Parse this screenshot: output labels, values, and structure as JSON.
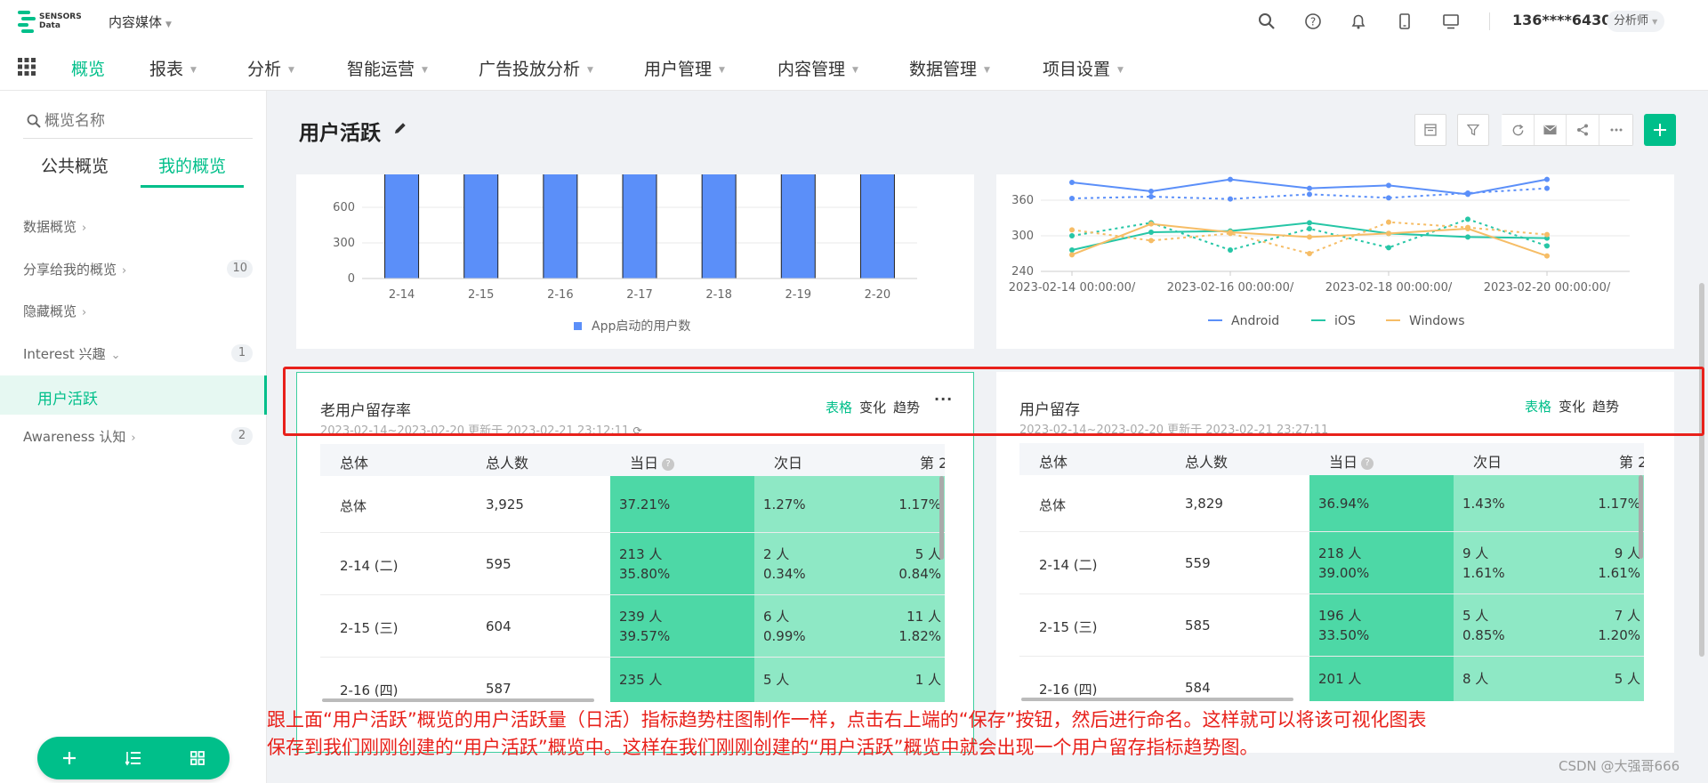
{
  "brand": {
    "name_line1": "SENSORS",
    "name_line2": "Data"
  },
  "workspace": "内容媒体",
  "user": {
    "phone": "136****6430",
    "role": "分析师"
  },
  "nav": [
    {
      "label": "概览",
      "active": true,
      "dropdown": false
    },
    {
      "label": "报表",
      "dropdown": true
    },
    {
      "label": "分析",
      "dropdown": true
    },
    {
      "label": "智能运营",
      "dropdown": true
    },
    {
      "label": "广告投放分析",
      "dropdown": true
    },
    {
      "label": "用户管理",
      "dropdown": true
    },
    {
      "label": "内容管理",
      "dropdown": true
    },
    {
      "label": "数据管理",
      "dropdown": true
    },
    {
      "label": "项目设置",
      "dropdown": true
    }
  ],
  "sidebar": {
    "search_placeholder": "概览名称",
    "tabs": [
      "公共概览",
      "我的概览"
    ],
    "items": [
      {
        "label": "数据概览",
        "count": ""
      },
      {
        "label": "分享给我的概览",
        "count": "10"
      },
      {
        "label": "隐藏概览",
        "count": ""
      },
      {
        "label": "Interest 兴趣",
        "count": "1"
      },
      {
        "label": "Awareness 认知",
        "count": "2"
      }
    ],
    "selected": "用户活跃"
  },
  "page": {
    "title": "用户活跃"
  },
  "chart_data": [
    {
      "type": "bar",
      "categories": [
        "2-14",
        "2-15",
        "2-16",
        "2-17",
        "2-18",
        "2-19",
        "2-20"
      ],
      "series": [
        {
          "name": "App启动的用户数",
          "color": "#5b8ff9",
          "values": [
            900,
            900,
            900,
            900,
            900,
            900,
            900
          ]
        }
      ],
      "yticks": [
        "0",
        "300",
        "600"
      ],
      "ylim": [
        0,
        900
      ]
    },
    {
      "type": "line",
      "x_labels": [
        "2023-02-14 00:00:00/",
        "2023-02-16 00:00:00/",
        "2023-02-18 00:00:00/",
        "2023-02-20 00:00:00/"
      ],
      "yticks": [
        "240",
        "300",
        "360"
      ],
      "ylim": [
        240,
        400
      ],
      "series": [
        {
          "name": "Android",
          "color": "#5b8ff9",
          "values": [
            390,
            375,
            395,
            380,
            385,
            370,
            395
          ],
          "compare": [
            363,
            366,
            362,
            370,
            364,
            372,
            380
          ]
        },
        {
          "name": "iOS",
          "color": "#26c6a6",
          "values": [
            276,
            306,
            308,
            322,
            304,
            298,
            296
          ],
          "compare": [
            300,
            322,
            276,
            312,
            280,
            328,
            283
          ]
        },
        {
          "name": "Windows",
          "color": "#f6bd66",
          "values": [
            268,
            320,
            306,
            298,
            304,
            312,
            266
          ],
          "compare": [
            310,
            292,
            304,
            270,
            323,
            314,
            302
          ]
        }
      ]
    }
  ],
  "retention_cards": [
    {
      "title": "老用户留存率",
      "subtitle": "2023-02-14~2023-02-20 更新于 2023-02-21 23:12:11",
      "views": [
        "表格",
        "变化",
        "趋势"
      ],
      "headers": [
        "总体",
        "总人数",
        "当日",
        "次日",
        "第 2"
      ],
      "rows": [
        {
          "label": "总体",
          "total": "3,925",
          "day0": [
            "37.21%"
          ],
          "day1": [
            "1.27%"
          ],
          "day2": [
            "1.17%"
          ]
        },
        {
          "label": "2-14 (二)",
          "total": "595",
          "day0": [
            "213 人",
            "35.80%"
          ],
          "day1": [
            "2 人",
            "0.34%"
          ],
          "day2": [
            "5 人",
            "0.84%"
          ]
        },
        {
          "label": "2-15 (三)",
          "total": "604",
          "day0": [
            "239 人",
            "39.57%"
          ],
          "day1": [
            "6 人",
            "0.99%"
          ],
          "day2": [
            "11 人",
            "1.82%"
          ]
        },
        {
          "label": "2-16 (四)",
          "total": "587",
          "day0": [
            "235 人"
          ],
          "day1": [
            "5 人"
          ],
          "day2": [
            "1 人"
          ]
        }
      ]
    },
    {
      "title": "用户留存",
      "subtitle": "2023-02-14~2023-02-20 更新于 2023-02-21 23:27:11",
      "views": [
        "表格",
        "变化",
        "趋势"
      ],
      "headers": [
        "总体",
        "总人数",
        "当日",
        "次日",
        "第 2"
      ],
      "rows": [
        {
          "label": "总体",
          "total": "3,829",
          "day0": [
            "36.94%"
          ],
          "day1": [
            "1.43%"
          ],
          "day2": [
            "1.17%"
          ]
        },
        {
          "label": "2-14 (二)",
          "total": "559",
          "day0": [
            "218 人",
            "39.00%"
          ],
          "day1": [
            "9 人",
            "1.61%"
          ],
          "day2": [
            "9 人",
            "1.61%"
          ]
        },
        {
          "label": "2-15 (三)",
          "total": "585",
          "day0": [
            "196 人",
            "33.50%"
          ],
          "day1": [
            "5 人",
            "0.85%"
          ],
          "day2": [
            "7 人",
            "1.20%"
          ]
        },
        {
          "label": "2-16 (四)",
          "total": "584",
          "day0": [
            "201 人"
          ],
          "day1": [
            "8 人"
          ],
          "day2": [
            "5 人"
          ]
        }
      ]
    }
  ],
  "annotation": {
    "line1": "跟上面“用户活跃”概览的用户活跃量（日活）指标趋势柱图制作一样，点击右上端的“保存”按钮，然后进行命名。这样就可以将该可视化图表",
    "line2": "保存到我们刚刚创建的“用户活跃”概览中。这样在我们刚刚创建的“用户活跃”概览中就会出现一个用户留存指标趋势图。"
  },
  "watermark": "CSDN @大强哥666",
  "colors": {
    "accent": "#00bf8a",
    "annotation_red": "#e8211b",
    "cell_dark": "#4dd8a6",
    "cell_light": "#8ee8c5"
  }
}
